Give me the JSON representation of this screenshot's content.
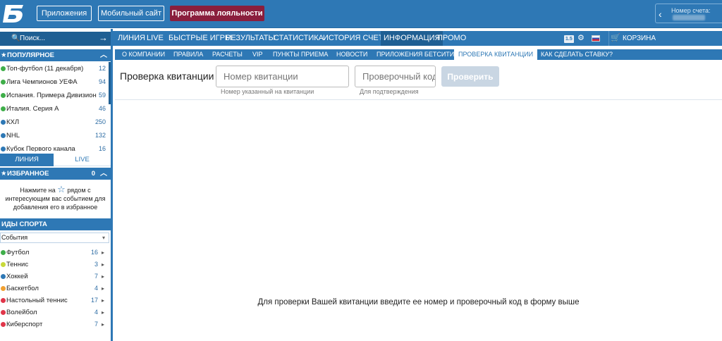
{
  "header": {
    "buttons": [
      "Приложения",
      "Мобильный сайт",
      "Программа лояльности"
    ],
    "account_label": "Номер счета:"
  },
  "sidebar": {
    "search_placeholder": "Поиск...",
    "popular_title": "ПОПУЛЯРНОЕ",
    "popular": [
      {
        "label": "Топ-футбол (11 декабря)",
        "count": "12",
        "color": "#3fae49"
      },
      {
        "label": "Лига Чемпионов УЕФА",
        "count": "94",
        "color": "#3fae49"
      },
      {
        "label": "Испания. Примера Дивизион",
        "count": "59",
        "color": "#3fae49"
      },
      {
        "label": "Италия. Серия А",
        "count": "46",
        "color": "#3fae49"
      },
      {
        "label": "КХЛ",
        "count": "250",
        "color": "#2e78b5"
      },
      {
        "label": "NHL",
        "count": "132",
        "color": "#2e78b5"
      },
      {
        "label": "Кубок Первого канала",
        "count": "16",
        "color": "#2e78b5"
      }
    ],
    "tab_line": "ЛИНИЯ",
    "tab_live": "LIVE",
    "favorites_title": "ИЗБРАННОЕ",
    "favorites_count": "0",
    "fav_text_1": "Нажмите на",
    "fav_text_2": "рядом с",
    "fav_text_3": "интересующим вас событием для",
    "fav_text_4": "добавления его в избранное",
    "sports_title": "ИДЫ СПОРТА",
    "sports_select": "События",
    "sports": [
      {
        "label": "Футбол",
        "count": "16",
        "color": "#3fae49"
      },
      {
        "label": "Теннис",
        "count": "3",
        "color": "#c8d93a"
      },
      {
        "label": "Хоккей",
        "count": "7",
        "color": "#2e78b5"
      },
      {
        "label": "Баскетбол",
        "count": "4",
        "color": "#f0a030"
      },
      {
        "label": "Настольный теннис",
        "count": "17",
        "color": "#e0364a"
      },
      {
        "label": "Волейбол",
        "count": "4",
        "color": "#e0364a"
      },
      {
        "label": "Киберспорт",
        "count": "7",
        "color": "#e0364a"
      }
    ]
  },
  "nav": {
    "items": [
      "ЛИНИЯ",
      "LIVE",
      "БЫСТРЫЕ ИГРЫ",
      "РЕЗУЛЬТАТЫ",
      "СТАТИСТИКА",
      "ИСТОРИЯ СЧЕТА",
      "ИНФОРМАЦИЯ",
      "ПРОМО"
    ],
    "version_badge": "1.5",
    "cart": "КОРЗИНА"
  },
  "subnav": {
    "items": [
      "О КОМПАНИИ",
      "ПРАВИЛА",
      "РАСЧЕТЫ",
      "VIP",
      "ПУНКТЫ ПРИЕМА",
      "НОВОСТИ",
      "ПРИЛОЖЕНИЯ БЕТСИТИ",
      "ПРОВЕРКА КВИТАНЦИИ",
      "КАК СДЕЛАТЬ СТАВКУ?"
    ]
  },
  "form": {
    "title": "Проверка квитанции",
    "ticket_placeholder": "Номер квитанции",
    "ticket_hint": "Номер указанный на квитанции",
    "code_placeholder": "Проверочный код",
    "code_hint": "Для подтверждения",
    "submit": "Проверить"
  },
  "message": "Для проверки Вашей квитанции введите ее номер и проверочный код в форму выше",
  "colors": {
    "primary": "#2e78b5",
    "dark": "#1f5f93",
    "loyalty": "#8a1e3d"
  }
}
